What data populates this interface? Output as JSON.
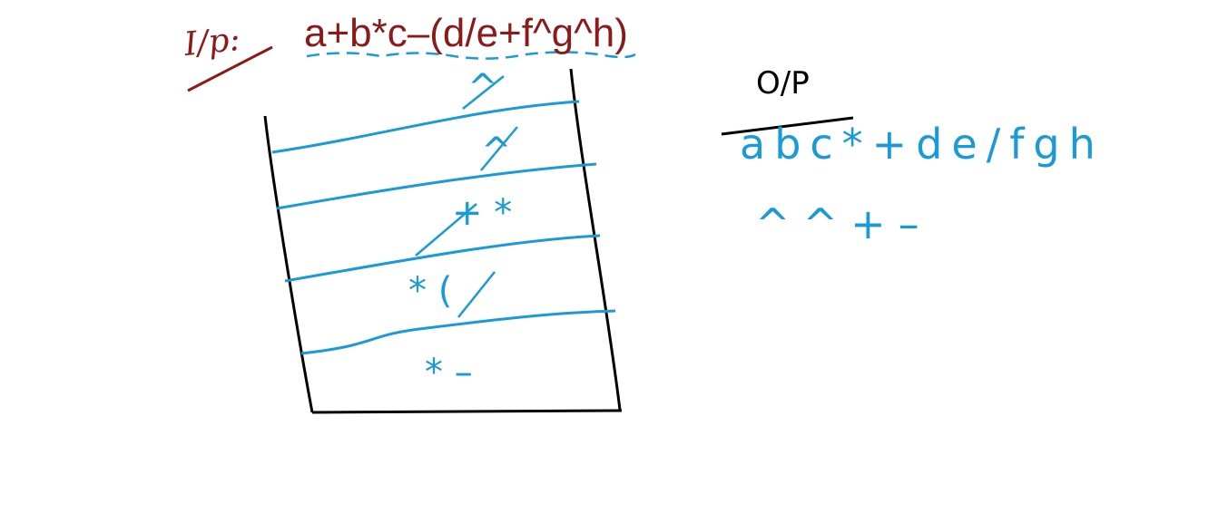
{
  "input": {
    "label": "I/p:",
    "expression": "a+b*c–(d/e+f^g^h)"
  },
  "output": {
    "label": "O/P",
    "line1": "abc*+de/fgh",
    "line2": "^^+–"
  },
  "stack": {
    "cells": [
      {
        "text": "^",
        "struck": true
      },
      {
        "text": "^",
        "struck": true
      },
      {
        "text": "+ *",
        "struck": true
      },
      {
        "text": "* (",
        "struck": true
      },
      {
        "text": "* –",
        "struck": true
      }
    ]
  },
  "colors": {
    "input_ink": "#8b1a1a",
    "stack_ink": "#1a9ad6",
    "border_ink": "#000000"
  }
}
